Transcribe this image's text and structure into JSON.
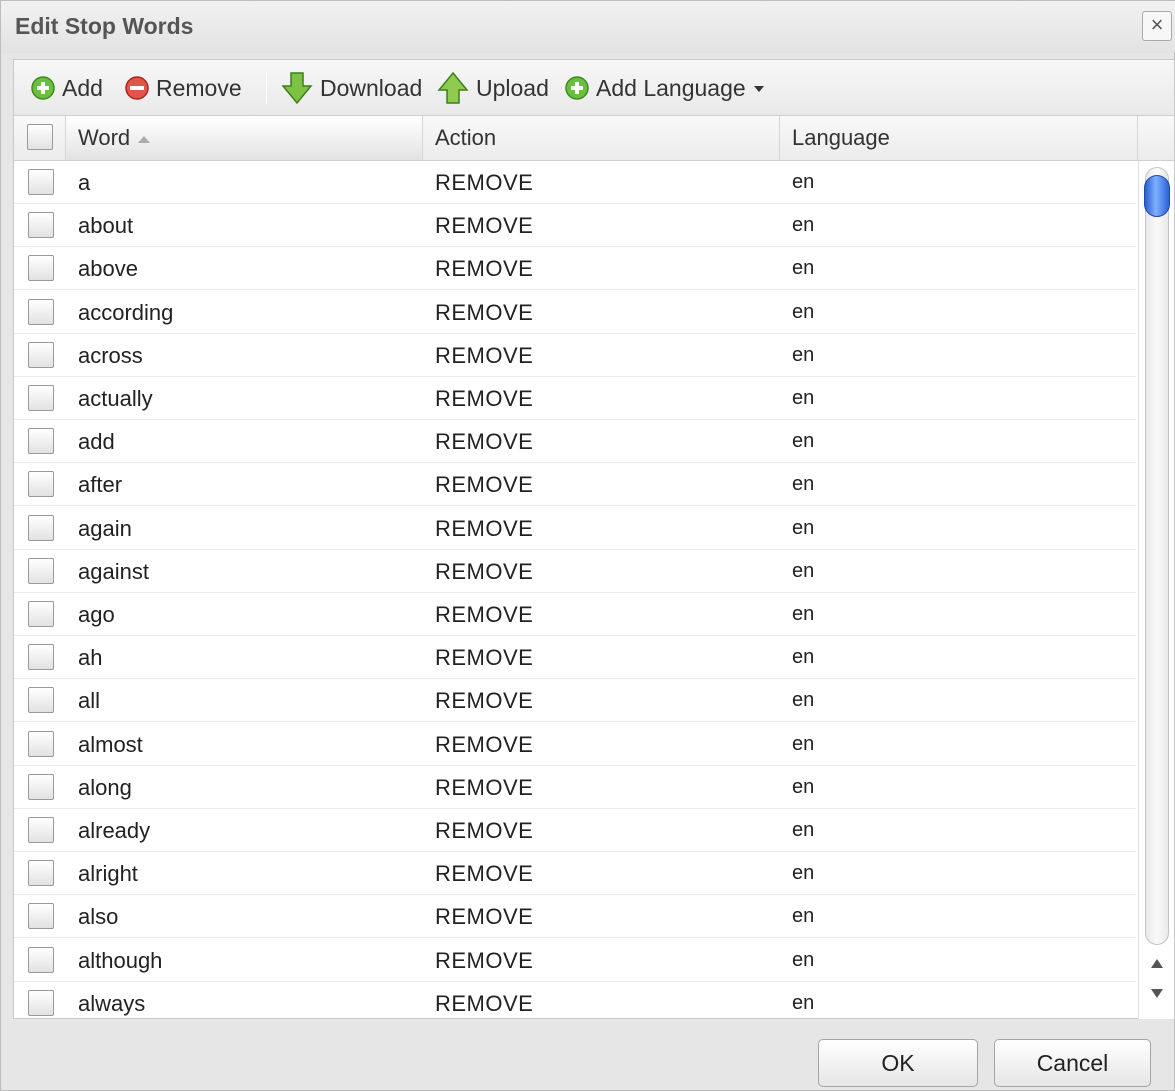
{
  "dialog": {
    "title": "Edit Stop Words",
    "close_label": "×"
  },
  "toolbar": {
    "add_label": "Add",
    "remove_label": "Remove",
    "download_label": "Download",
    "upload_label": "Upload",
    "add_language_label": "Add Language"
  },
  "grid": {
    "columns": {
      "word": "Word",
      "action": "Action",
      "language": "Language"
    },
    "rows": [
      {
        "word": "a",
        "action": "REMOVE",
        "language": "en"
      },
      {
        "word": "about",
        "action": "REMOVE",
        "language": "en"
      },
      {
        "word": "above",
        "action": "REMOVE",
        "language": "en"
      },
      {
        "word": "according",
        "action": "REMOVE",
        "language": "en"
      },
      {
        "word": "across",
        "action": "REMOVE",
        "language": "en"
      },
      {
        "word": "actually",
        "action": "REMOVE",
        "language": "en"
      },
      {
        "word": "add",
        "action": "REMOVE",
        "language": "en"
      },
      {
        "word": "after",
        "action": "REMOVE",
        "language": "en"
      },
      {
        "word": "again",
        "action": "REMOVE",
        "language": "en"
      },
      {
        "word": "against",
        "action": "REMOVE",
        "language": "en"
      },
      {
        "word": "ago",
        "action": "REMOVE",
        "language": "en"
      },
      {
        "word": "ah",
        "action": "REMOVE",
        "language": "en"
      },
      {
        "word": "all",
        "action": "REMOVE",
        "language": "en"
      },
      {
        "word": "almost",
        "action": "REMOVE",
        "language": "en"
      },
      {
        "word": "along",
        "action": "REMOVE",
        "language": "en"
      },
      {
        "word": "already",
        "action": "REMOVE",
        "language": "en"
      },
      {
        "word": "alright",
        "action": "REMOVE",
        "language": "en"
      },
      {
        "word": "also",
        "action": "REMOVE",
        "language": "en"
      },
      {
        "word": "although",
        "action": "REMOVE",
        "language": "en"
      },
      {
        "word": "always",
        "action": "REMOVE",
        "language": "en"
      }
    ]
  },
  "footer": {
    "ok_label": "OK",
    "cancel_label": "Cancel"
  },
  "icons": {
    "add": "plus-circle-green",
    "remove": "minus-circle-red",
    "download": "arrow-down-green",
    "upload": "arrow-up-green",
    "add_language": "plus-circle-green"
  },
  "colors": {
    "add_green": "#5fb336",
    "remove_red": "#d9463c",
    "scroll_thumb_blue": "#3b74e0"
  }
}
